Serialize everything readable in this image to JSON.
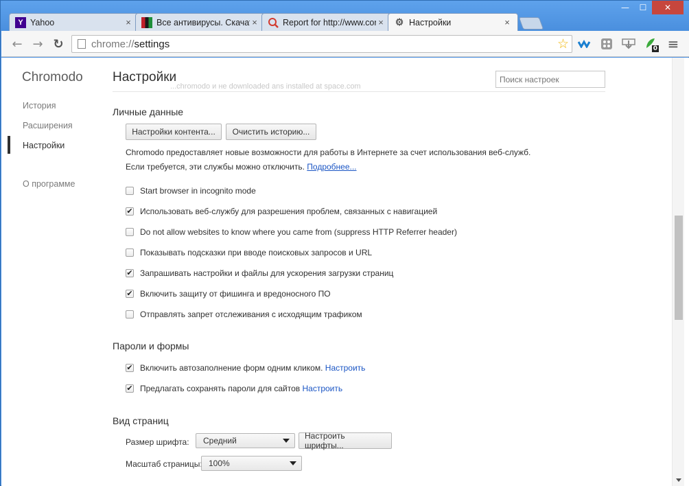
{
  "window": {
    "minimize_glyph": "—",
    "maximize_glyph": "☐",
    "close_glyph": "✕"
  },
  "tabs": [
    {
      "title": "Yahoo",
      "icon": "yahoo-icon",
      "favicon_glyph": "Y",
      "favicon_color": "#400090"
    },
    {
      "title": "Все антивирусы. Скачать",
      "icon": "flag-icon",
      "favicon_glyph": "",
      "favicon_color": "#c0202a"
    },
    {
      "title": "Report for http://www.cor",
      "icon": "report-icon",
      "favicon_glyph": "",
      "favicon_color": "#d23a2e"
    },
    {
      "title": "Настройки",
      "icon": "gear-icon",
      "favicon_glyph": "⚙",
      "favicon_color": "#555555"
    }
  ],
  "tab_close_glyph": "×",
  "toolbar": {
    "back_glyph": "←",
    "forward_glyph": "→",
    "reload_glyph": "↻",
    "url_scheme": "chrome://",
    "url_path": "settings",
    "star_glyph": "☆",
    "menu_glyph": "≡",
    "ext_badge": "0"
  },
  "sidebar": {
    "brand": "Chromodo",
    "items": [
      "История",
      "Расширения",
      "Настройки",
      "О программе"
    ]
  },
  "main": {
    "title": "Настройки",
    "ghost_text": "...chromodo и не downloaded ans installed at space.com",
    "search_placeholder": "Поиск настроек",
    "privacy": {
      "heading": "Личные данные",
      "content_settings_button": "Настройки контента...",
      "clear_history_button": "Очистить историю...",
      "description_line1": "Chromodo предоставляет новые возможности для работы в Интернете за счет использования веб-служб.",
      "description_line2": "Если требуется, эти службы можно отключить.",
      "more_link": "Подробнее...",
      "checkboxes": [
        {
          "label": "Start browser in incognito mode",
          "checked": false
        },
        {
          "label": "Использовать веб-службу для разрешения проблем, связанных с навигацией",
          "checked": true
        },
        {
          "label": "Do not allow websites to know where you came from (suppress HTTP Referrer header)",
          "checked": false
        },
        {
          "label": "Показывать подсказки при вводе поисковых запросов и URL",
          "checked": false
        },
        {
          "label": "Запрашивать настройки и файлы для ускорения загрузки страниц",
          "checked": true
        },
        {
          "label": "Включить защиту от фишинга и вредоносного ПО",
          "checked": true
        },
        {
          "label": "Отправлять запрет отслеживания с исходящим трафиком",
          "checked": false
        }
      ],
      "check_glyph": "✔"
    },
    "passwords": {
      "heading": "Пароли и формы",
      "autofill_label": "Включить автозаполнение форм одним кликом.",
      "autofill_link": "Настроить",
      "save_passwords_label": "Предлагать сохранять пароли для сайтов",
      "save_passwords_link": "Настроить"
    },
    "web_content": {
      "heading": "Вид страниц",
      "font_size_label": "Размер шрифта:",
      "font_size_value": "Средний",
      "customize_fonts_button": "Настроить шрифты...",
      "zoom_label": "Масштаб страницы:",
      "zoom_value": "100%"
    }
  }
}
